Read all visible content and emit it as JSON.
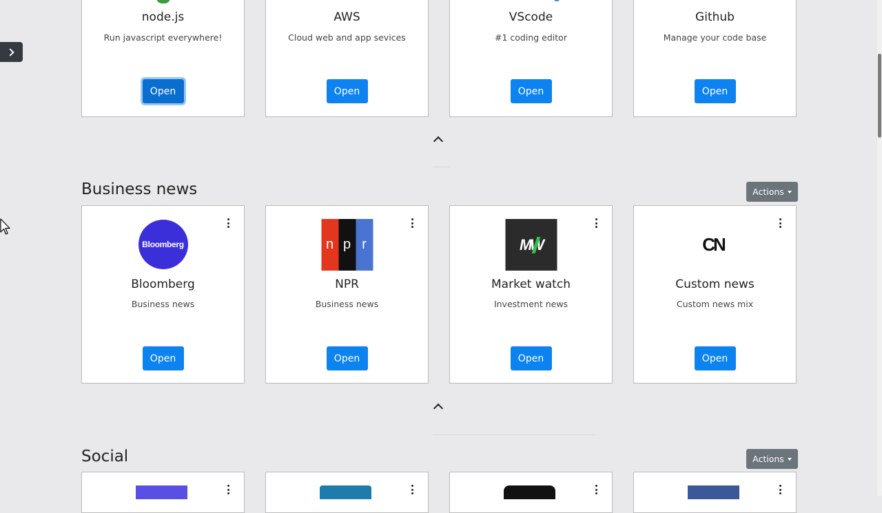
{
  "sidebar_toggle": {
    "icon": "chevron-right-icon"
  },
  "dev_tools": [
    {
      "name": "node.js",
      "description": "Run javascript everywhere!",
      "button": "Open",
      "focused": true
    },
    {
      "name": "AWS",
      "description": "Cloud web and app sevices",
      "button": "Open"
    },
    {
      "name": "VScode",
      "description": "#1 coding editor",
      "button": "Open"
    },
    {
      "name": "Github",
      "description": "Manage your code base",
      "button": "Open"
    }
  ],
  "business_news": {
    "title": "Business news",
    "actions_label": "Actions",
    "cards": [
      {
        "name": "Bloomberg",
        "description": "Business news",
        "button": "Open",
        "logo_text": "Bloomberg",
        "logo_color": "#3b2fd9"
      },
      {
        "name": "NPR",
        "description": "Business news",
        "button": "Open",
        "logo_letters": [
          "n",
          "p",
          "r"
        ],
        "logo_colors": [
          "#e3361f",
          "#111111",
          "#4a74d1"
        ]
      },
      {
        "name": "Market watch",
        "description": "Investment news",
        "button": "Open",
        "logo_text": "MW",
        "logo_color": "#2b2b2b"
      },
      {
        "name": "Custom news",
        "description": "Custom news mix",
        "button": "Open",
        "logo_text": "CN"
      }
    ]
  },
  "social": {
    "title": "Social",
    "actions_label": "Actions"
  },
  "colors": {
    "accent": "#0d83f2",
    "background": "#e9e9eb",
    "actions": "#6b747b"
  }
}
